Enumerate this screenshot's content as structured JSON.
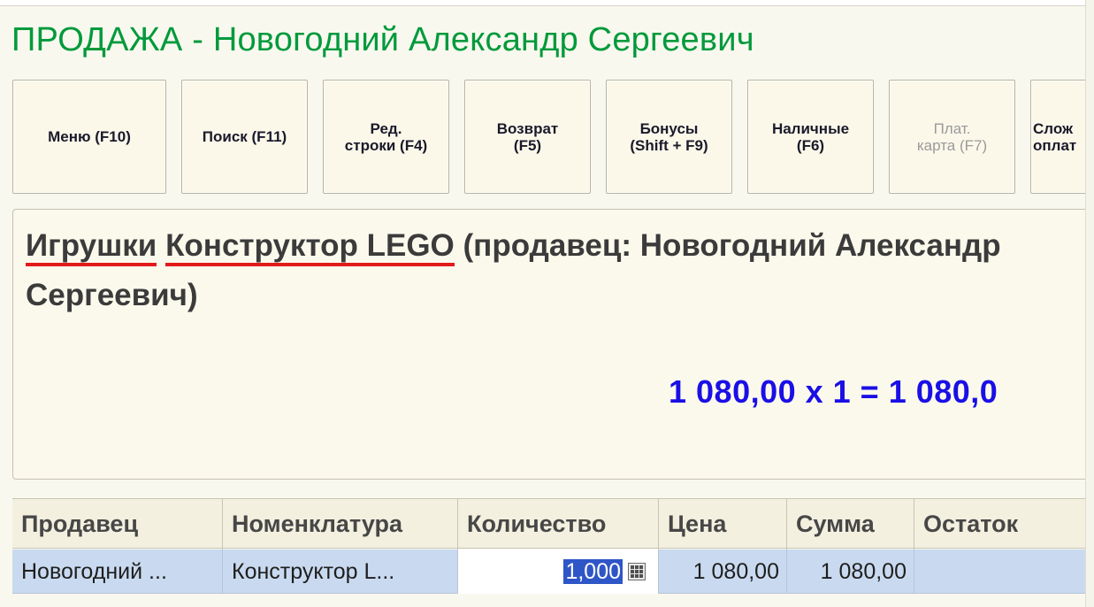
{
  "form": {
    "title": "ПРОДАЖА - Новогодний Александр Сергеевич"
  },
  "toolbar": {
    "menu": "Меню (F10)",
    "search": "Поиск (F11)",
    "edit_line": "Ред.\nстроки (F4)",
    "return": "Возврат\n(F5)",
    "bonuses": "Бонусы\n(Shift + F9)",
    "cash": "Наличные\n(F6)",
    "card": "Плат.\nкарта (F7)",
    "complex": "Слож\nоплат"
  },
  "current_item": {
    "category": "Игрушки",
    "product": "Конструктор LEGO",
    "seller_note": " (продавец: Новогодний Александр Сергеевич)",
    "calc": "1 080,00  x 1  = 1 080,0"
  },
  "table": {
    "columns": [
      "Продавец",
      "Номенклатура",
      "Количество",
      "Цена",
      "Сумма",
      "Остаток"
    ],
    "rows": [
      {
        "seller": "Новогодний ...",
        "product": "Конструктор L...",
        "quantity": "1,000",
        "price": "1 080,00",
        "sum": "1 080,00",
        "stock": ""
      }
    ]
  },
  "colors": {
    "title": "#009a3b",
    "calc": "#1a0fe6",
    "underline": "#e21a1a",
    "selected_row": "#c9daf0"
  }
}
